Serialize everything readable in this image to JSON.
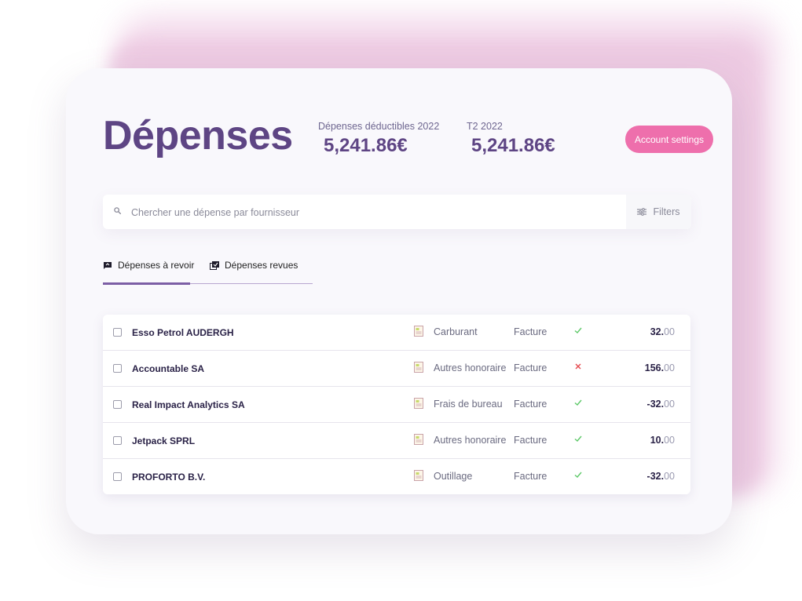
{
  "header": {
    "title": "Dépenses",
    "stats": [
      {
        "label": "Dépenses déductibles 2022",
        "value": "5,241.86€"
      },
      {
        "label": "T2 2022",
        "value": "5,241.86€"
      }
    ],
    "settings_label": "Account settings"
  },
  "search": {
    "placeholder": "Chercher une dépense par fournisseur",
    "filters_label": "Filters"
  },
  "tabs": [
    {
      "label": "Dépenses à revoir",
      "active": true
    },
    {
      "label": "Dépenses revues",
      "active": false
    }
  ],
  "expenses": [
    {
      "vendor": "Esso Petrol AUDERGH",
      "category": "Carburant",
      "type": "Facture",
      "status": "check",
      "amount_int": "32.",
      "amount_dec": "00"
    },
    {
      "vendor": "Accountable SA",
      "category": "Autres honoraire",
      "type": "Facture",
      "status": "cross",
      "amount_int": "156.",
      "amount_dec": "00"
    },
    {
      "vendor": "Real Impact Analytics SA",
      "category": "Frais de bureau",
      "type": "Facture",
      "status": "check",
      "amount_int": "-32.",
      "amount_dec": "00"
    },
    {
      "vendor": "Jetpack SPRL",
      "category": "Autres honoraire",
      "type": "Facture",
      "status": "check",
      "amount_int": "10.",
      "amount_dec": "00"
    },
    {
      "vendor": "PROFORTO B.V.",
      "category": "Outillage",
      "type": "Facture",
      "status": "check",
      "amount_int": "-32.",
      "amount_dec": "00"
    }
  ],
  "colors": {
    "accent": "#5e4584",
    "button": "#ee6fac",
    "check": "#5fc96a",
    "cross": "#e5484d"
  }
}
